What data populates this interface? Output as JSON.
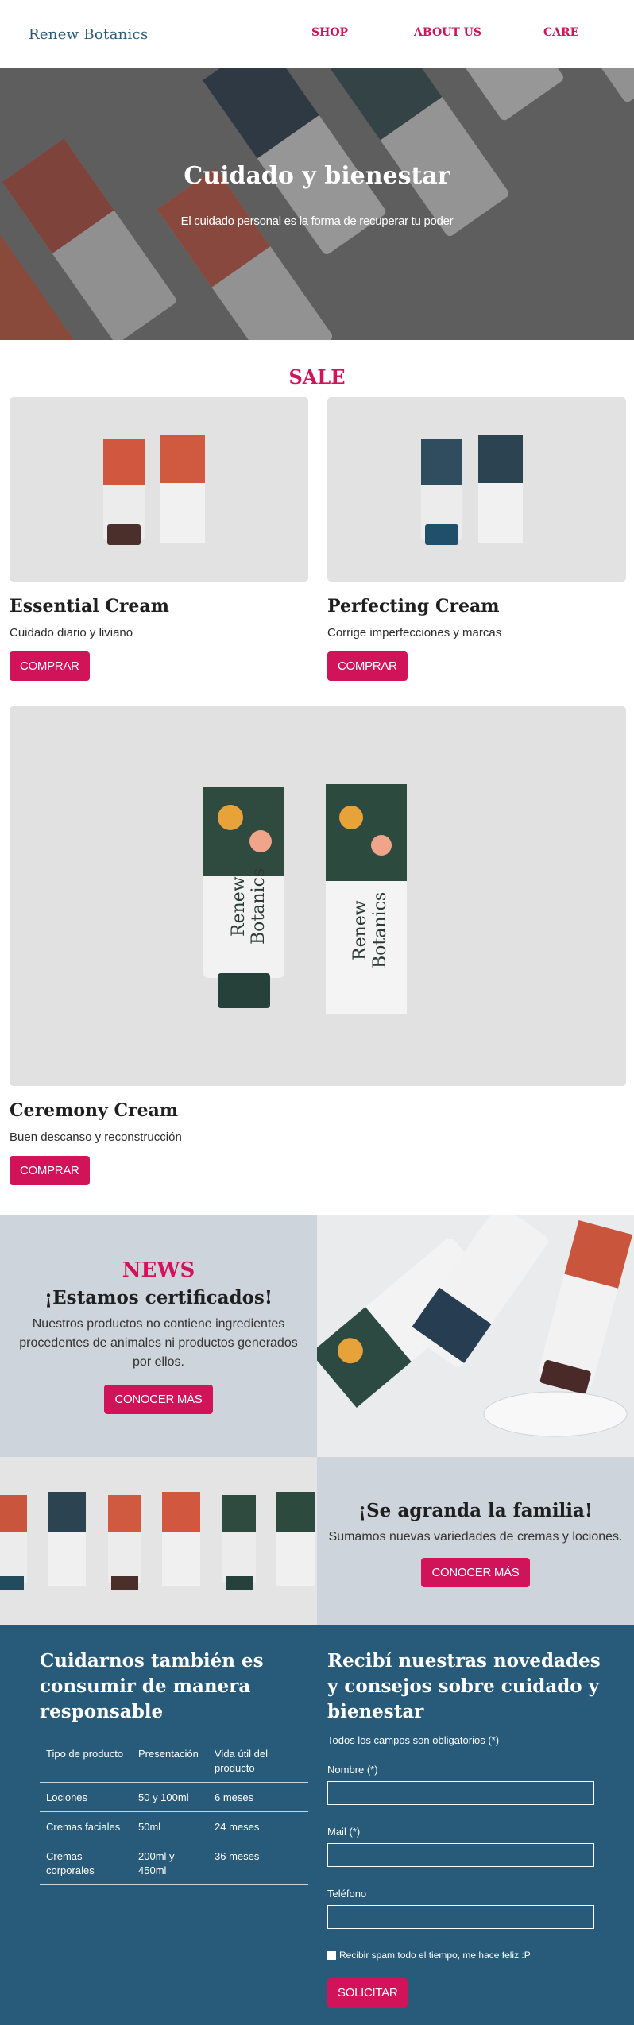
{
  "header": {
    "logo": "Renew Botanics",
    "nav": [
      "SHOP",
      "ABOUT US",
      "CARE"
    ]
  },
  "hero": {
    "title": "Cuidado y bienestar",
    "subtitle": "El cuidado personal es la forma de recuperar tu poder"
  },
  "sale": {
    "title": "SALE",
    "products": [
      {
        "name": "Essential Cream",
        "desc": "Cuidado diario y liviano",
        "button": "COMPRAR"
      },
      {
        "name": "Perfecting Cream",
        "desc": "Corrige imperfecciones y marcas",
        "button": "COMPRAR"
      },
      {
        "name": "Ceremony Cream",
        "desc": "Buen descanso y reconstrucción",
        "button": "COMPRAR"
      }
    ]
  },
  "news": {
    "label": "NEWS",
    "heading": "¡Estamos certificados!",
    "text": "Nuestros productos no contiene ingredientes procedentes de animales ni productos generados por ellos.",
    "button": "CONOCER MÁS"
  },
  "family": {
    "heading": "¡Se agranda la familia!",
    "text": "Sumamos nuevas variedades de cremas y lociones.",
    "button": "CONOCER MÁS"
  },
  "footer": {
    "table_title": "Cuidarnos también es consumir de manera responsable",
    "table": {
      "headers": [
        "Tipo de producto",
        "Presentación",
        "Vida útil del producto"
      ],
      "rows": [
        [
          "Lociones",
          "50 y 100ml",
          "6 meses"
        ],
        [
          "Cremas faciales",
          "50ml",
          "24 meses"
        ],
        [
          "Cremas corporales",
          "200ml y 450ml",
          "36 meses"
        ]
      ]
    },
    "form_title": "Recibí nuestras novedades y consejos sobre cuidado y bienestar",
    "required_note": "Todos los campos son obligatorios (*)",
    "fields": [
      {
        "label": "Nombre (*)",
        "value": ""
      },
      {
        "label": "Mail (*)",
        "value": ""
      },
      {
        "label": "Teléfono",
        "value": ""
      }
    ],
    "checkbox_label": "Recibir spam todo el tiempo, me hace feliz :P",
    "submit": "SOLICITAR"
  },
  "product_labels": {
    "brand_line1": "Renew",
    "brand_line2": "Botanics"
  },
  "colors": {
    "accent": "#d1145a",
    "brand_blue": "#285a79",
    "panel_gray": "#cdd4db"
  }
}
